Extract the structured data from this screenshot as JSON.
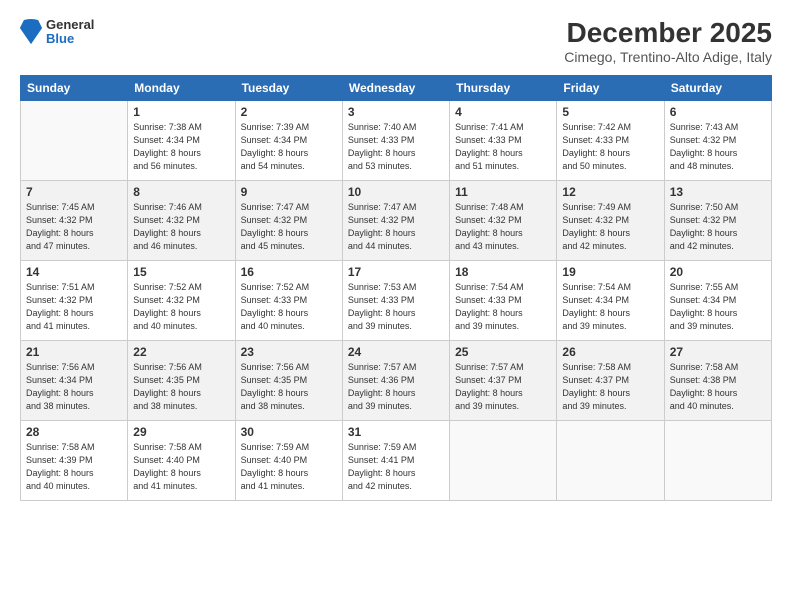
{
  "logo": {
    "general": "General",
    "blue": "Blue"
  },
  "header": {
    "title": "December 2025",
    "subtitle": "Cimego, Trentino-Alto Adige, Italy"
  },
  "weekdays": [
    "Sunday",
    "Monday",
    "Tuesday",
    "Wednesday",
    "Thursday",
    "Friday",
    "Saturday"
  ],
  "weeks": [
    [
      {
        "day": "",
        "info": ""
      },
      {
        "day": "1",
        "info": "Sunrise: 7:38 AM\nSunset: 4:34 PM\nDaylight: 8 hours\nand 56 minutes."
      },
      {
        "day": "2",
        "info": "Sunrise: 7:39 AM\nSunset: 4:34 PM\nDaylight: 8 hours\nand 54 minutes."
      },
      {
        "day": "3",
        "info": "Sunrise: 7:40 AM\nSunset: 4:33 PM\nDaylight: 8 hours\nand 53 minutes."
      },
      {
        "day": "4",
        "info": "Sunrise: 7:41 AM\nSunset: 4:33 PM\nDaylight: 8 hours\nand 51 minutes."
      },
      {
        "day": "5",
        "info": "Sunrise: 7:42 AM\nSunset: 4:33 PM\nDaylight: 8 hours\nand 50 minutes."
      },
      {
        "day": "6",
        "info": "Sunrise: 7:43 AM\nSunset: 4:32 PM\nDaylight: 8 hours\nand 48 minutes."
      }
    ],
    [
      {
        "day": "7",
        "info": "Sunrise: 7:45 AM\nSunset: 4:32 PM\nDaylight: 8 hours\nand 47 minutes."
      },
      {
        "day": "8",
        "info": "Sunrise: 7:46 AM\nSunset: 4:32 PM\nDaylight: 8 hours\nand 46 minutes."
      },
      {
        "day": "9",
        "info": "Sunrise: 7:47 AM\nSunset: 4:32 PM\nDaylight: 8 hours\nand 45 minutes."
      },
      {
        "day": "10",
        "info": "Sunrise: 7:47 AM\nSunset: 4:32 PM\nDaylight: 8 hours\nand 44 minutes."
      },
      {
        "day": "11",
        "info": "Sunrise: 7:48 AM\nSunset: 4:32 PM\nDaylight: 8 hours\nand 43 minutes."
      },
      {
        "day": "12",
        "info": "Sunrise: 7:49 AM\nSunset: 4:32 PM\nDaylight: 8 hours\nand 42 minutes."
      },
      {
        "day": "13",
        "info": "Sunrise: 7:50 AM\nSunset: 4:32 PM\nDaylight: 8 hours\nand 42 minutes."
      }
    ],
    [
      {
        "day": "14",
        "info": "Sunrise: 7:51 AM\nSunset: 4:32 PM\nDaylight: 8 hours\nand 41 minutes."
      },
      {
        "day": "15",
        "info": "Sunrise: 7:52 AM\nSunset: 4:32 PM\nDaylight: 8 hours\nand 40 minutes."
      },
      {
        "day": "16",
        "info": "Sunrise: 7:52 AM\nSunset: 4:33 PM\nDaylight: 8 hours\nand 40 minutes."
      },
      {
        "day": "17",
        "info": "Sunrise: 7:53 AM\nSunset: 4:33 PM\nDaylight: 8 hours\nand 39 minutes."
      },
      {
        "day": "18",
        "info": "Sunrise: 7:54 AM\nSunset: 4:33 PM\nDaylight: 8 hours\nand 39 minutes."
      },
      {
        "day": "19",
        "info": "Sunrise: 7:54 AM\nSunset: 4:34 PM\nDaylight: 8 hours\nand 39 minutes."
      },
      {
        "day": "20",
        "info": "Sunrise: 7:55 AM\nSunset: 4:34 PM\nDaylight: 8 hours\nand 39 minutes."
      }
    ],
    [
      {
        "day": "21",
        "info": "Sunrise: 7:56 AM\nSunset: 4:34 PM\nDaylight: 8 hours\nand 38 minutes."
      },
      {
        "day": "22",
        "info": "Sunrise: 7:56 AM\nSunset: 4:35 PM\nDaylight: 8 hours\nand 38 minutes."
      },
      {
        "day": "23",
        "info": "Sunrise: 7:56 AM\nSunset: 4:35 PM\nDaylight: 8 hours\nand 38 minutes."
      },
      {
        "day": "24",
        "info": "Sunrise: 7:57 AM\nSunset: 4:36 PM\nDaylight: 8 hours\nand 39 minutes."
      },
      {
        "day": "25",
        "info": "Sunrise: 7:57 AM\nSunset: 4:37 PM\nDaylight: 8 hours\nand 39 minutes."
      },
      {
        "day": "26",
        "info": "Sunrise: 7:58 AM\nSunset: 4:37 PM\nDaylight: 8 hours\nand 39 minutes."
      },
      {
        "day": "27",
        "info": "Sunrise: 7:58 AM\nSunset: 4:38 PM\nDaylight: 8 hours\nand 40 minutes."
      }
    ],
    [
      {
        "day": "28",
        "info": "Sunrise: 7:58 AM\nSunset: 4:39 PM\nDaylight: 8 hours\nand 40 minutes."
      },
      {
        "day": "29",
        "info": "Sunrise: 7:58 AM\nSunset: 4:40 PM\nDaylight: 8 hours\nand 41 minutes."
      },
      {
        "day": "30",
        "info": "Sunrise: 7:59 AM\nSunset: 4:40 PM\nDaylight: 8 hours\nand 41 minutes."
      },
      {
        "day": "31",
        "info": "Sunrise: 7:59 AM\nSunset: 4:41 PM\nDaylight: 8 hours\nand 42 minutes."
      },
      {
        "day": "",
        "info": ""
      },
      {
        "day": "",
        "info": ""
      },
      {
        "day": "",
        "info": ""
      }
    ]
  ]
}
